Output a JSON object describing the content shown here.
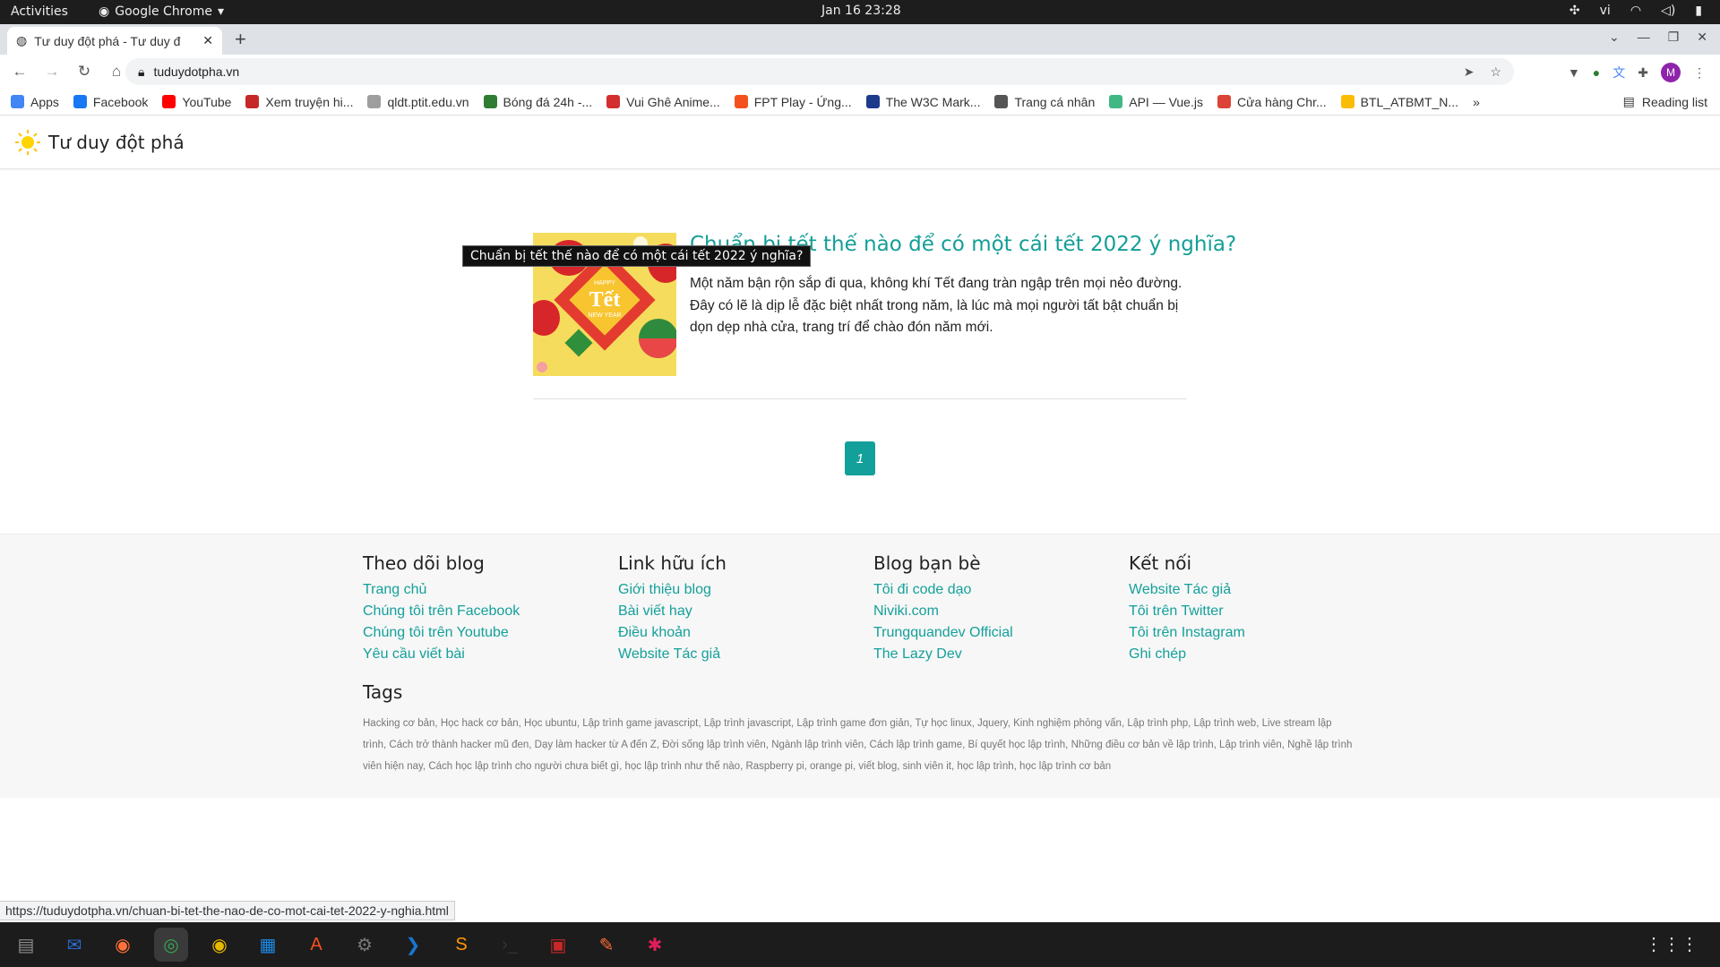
{
  "os": {
    "activities": "Activities",
    "app_menu": "Google Chrome",
    "clock": "Jan 16  23:28",
    "lang": "vi"
  },
  "browser": {
    "tab_title": "Tư duy đột phá - Tư duy đ",
    "url": "tuduydotpha.vn",
    "bookmarks": [
      {
        "label": "Apps",
        "color": "#4285f4"
      },
      {
        "label": "Facebook",
        "color": "#1877f2"
      },
      {
        "label": "YouTube",
        "color": "#ff0000"
      },
      {
        "label": "Xem truyện hi...",
        "color": "#c62828"
      },
      {
        "label": "qldt.ptit.edu.vn",
        "color": "#9e9e9e"
      },
      {
        "label": "Bóng đá 24h -...",
        "color": "#2e7d32"
      },
      {
        "label": "Vui Ghê Anime...",
        "color": "#d32f2f"
      },
      {
        "label": "FPT Play - Ứng...",
        "color": "#f4511e"
      },
      {
        "label": "The W3C Mark...",
        "color": "#1e3a8a"
      },
      {
        "label": "Trang cá nhân",
        "color": "#555555"
      },
      {
        "label": "API — Vue.js",
        "color": "#41b883"
      },
      {
        "label": "Cửa hàng Chr...",
        "color": "#db4437"
      },
      {
        "label": "BTL_ATBMT_N...",
        "color": "#fbbc04"
      }
    ],
    "more": "»",
    "reading_list": "Reading list",
    "status_url": "https://tuduydotpha.vn/chuan-bi-tet-the-nao-de-co-mot-cai-tet-2022-y-nghia.html"
  },
  "site": {
    "name": "Tư duy đột phá",
    "accent": "#14a09a"
  },
  "post": {
    "title": "Chuẩn bị tết thế nào để có một cái tết 2022 ý nghĩa?",
    "tooltip": "Chuẩn bị tết thế nào để có một cái tết 2022 ý nghĩa?",
    "excerpt": "Một năm bận rộn sắp đi qua, không khí Tết đang tràn ngập trên mọi nẻo đường. Đây có lẽ là dịp lễ đặc biệt nhất trong năm, là lúc mà mọi người tất bật chuẩn bị dọn dẹp nhà cửa, trang trí để chào đón năm mới.",
    "thumb_text_1": "HAPPY",
    "thumb_text_2": "Tết",
    "thumb_text_3": "NEW YEAR"
  },
  "pagination": {
    "current": "1"
  },
  "footer": {
    "columns": [
      {
        "title": "Theo dõi blog",
        "links": [
          "Trang chủ",
          "Chúng tôi trên Facebook",
          "Chúng tôi trên Youtube",
          "Yêu cầu viết bài"
        ]
      },
      {
        "title": "Link hữu ích",
        "links": [
          "Giới thiệu blog",
          "Bài viết hay",
          "Điều khoản",
          "Website Tác giả"
        ]
      },
      {
        "title": "Blog bạn bè",
        "links": [
          "Tôi đi code dạo",
          "Niviki.com",
          "Trungquandev Official",
          "The Lazy Dev"
        ]
      },
      {
        "title": "Kết nối",
        "links": [
          "Website Tác giả",
          "Tôi trên Twitter",
          "Tôi trên Instagram",
          "Ghi chép"
        ]
      }
    ],
    "tags_title": "Tags",
    "tags": [
      "Hacking cơ bản",
      "Học hack cơ bản",
      "Học ubuntu",
      "Lập trình game javascript",
      "Lập trình javascript",
      "Lập trình game đơn giản",
      "Tự học linux",
      "Jquery",
      "Kinh nghiệm phỏng vấn",
      "Lập trình php",
      "Lập trình web",
      "Live stream lập trình",
      "Cách trở thành hacker mũ đen",
      "Dạy làm hacker từ A đến Z",
      "Đời sống lập trình viên",
      "Ngành lập trình viên",
      "Cách lập trình game",
      "Bí quyết học lập trình",
      "Những điều cơ bản về lập trình",
      "Lập trình viên",
      "Nghề lập trình viên hiện nay",
      "Cách học lập trình cho người chưa biết gì",
      "học lập trình như thế nào",
      "Raspberry pi, orange pi",
      "viết blog",
      "sinh viên it",
      "học lập trình",
      "học lập trình cơ bản"
    ]
  },
  "dock": [
    {
      "name": "files-icon",
      "color": "#8d8d8d",
      "glyph": "▤"
    },
    {
      "name": "thunderbird-icon",
      "color": "#2a6dd3",
      "glyph": "✉"
    },
    {
      "name": "firefox-icon",
      "color": "#ff7139",
      "glyph": "◉"
    },
    {
      "name": "chrome-icon",
      "color": "#34a853",
      "glyph": "◎"
    },
    {
      "name": "rhythmbox-icon",
      "color": "#e8b800",
      "glyph": "◉"
    },
    {
      "name": "writer-icon",
      "color": "#1e88e5",
      "glyph": "▦"
    },
    {
      "name": "software-center-icon",
      "color": "#f4511e",
      "glyph": "A"
    },
    {
      "name": "settings-icon",
      "color": "#777",
      "glyph": "⚙"
    },
    {
      "name": "vscode-icon",
      "color": "#1976d2",
      "glyph": "❯"
    },
    {
      "name": "sublime-icon",
      "color": "#ff9800",
      "glyph": "S"
    },
    {
      "name": "terminal-icon",
      "color": "#333",
      "glyph": "›_"
    },
    {
      "name": "screenshot-icon",
      "color": "#c62828",
      "glyph": "▣"
    },
    {
      "name": "postman-icon",
      "color": "#ff6c37",
      "glyph": "✎"
    },
    {
      "name": "slack-icon",
      "color": "#e01e5a",
      "glyph": "✱"
    }
  ]
}
